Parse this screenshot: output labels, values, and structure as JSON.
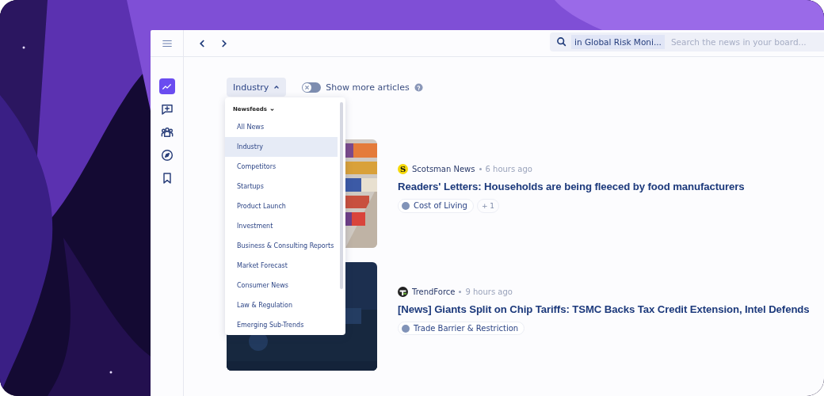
{
  "topbar": {
    "search": {
      "scope": "in Global Risk Moni...",
      "placeholder": "Search the news in your board..."
    }
  },
  "sidebar": {
    "items": [
      {
        "kind": "trend",
        "selected": true
      },
      {
        "kind": "add-chat",
        "selected": false
      },
      {
        "kind": "team",
        "selected": false
      },
      {
        "kind": "compass",
        "selected": false
      },
      {
        "kind": "bookmark",
        "selected": false
      }
    ]
  },
  "filter": {
    "label": "Industry",
    "expanded": true
  },
  "toggle": {
    "label": "Show more articles",
    "on": false
  },
  "dropdown": {
    "heading": "Newsfeeds",
    "items": [
      {
        "label": "All News",
        "selected": false
      },
      {
        "label": "Industry",
        "selected": true
      },
      {
        "label": "Competitors",
        "selected": false
      },
      {
        "label": "Startups",
        "selected": false
      },
      {
        "label": "Product Launch",
        "selected": false
      },
      {
        "label": "Investment",
        "selected": false
      },
      {
        "label": "Business & Consulting Reports",
        "selected": false
      },
      {
        "label": "Market Forecast",
        "selected": false
      },
      {
        "label": "Consumer News",
        "selected": false
      },
      {
        "label": "Law & Regulation",
        "selected": false
      },
      {
        "label": "Emerging Sub-Trends",
        "selected": false
      }
    ]
  },
  "articles": [
    {
      "logo": {
        "kind": "letter",
        "text": "S"
      },
      "source": "Scotsman News",
      "time": "6 hours ago",
      "title": "Readers' Letters: Households are being fleeced by food manufacturers",
      "tags": [
        "Cost of Living"
      ],
      "more": "+ 1"
    },
    {
      "logo": {
        "kind": "mark"
      },
      "source": "TrendForce",
      "time": "9 hours ago",
      "title": "[News] Giants Split on Chip Tariffs: TSMC Backs Tax Credit Extension, Intel Defends",
      "tags": [
        "Trade Barrier & Restriction"
      ]
    }
  ]
}
